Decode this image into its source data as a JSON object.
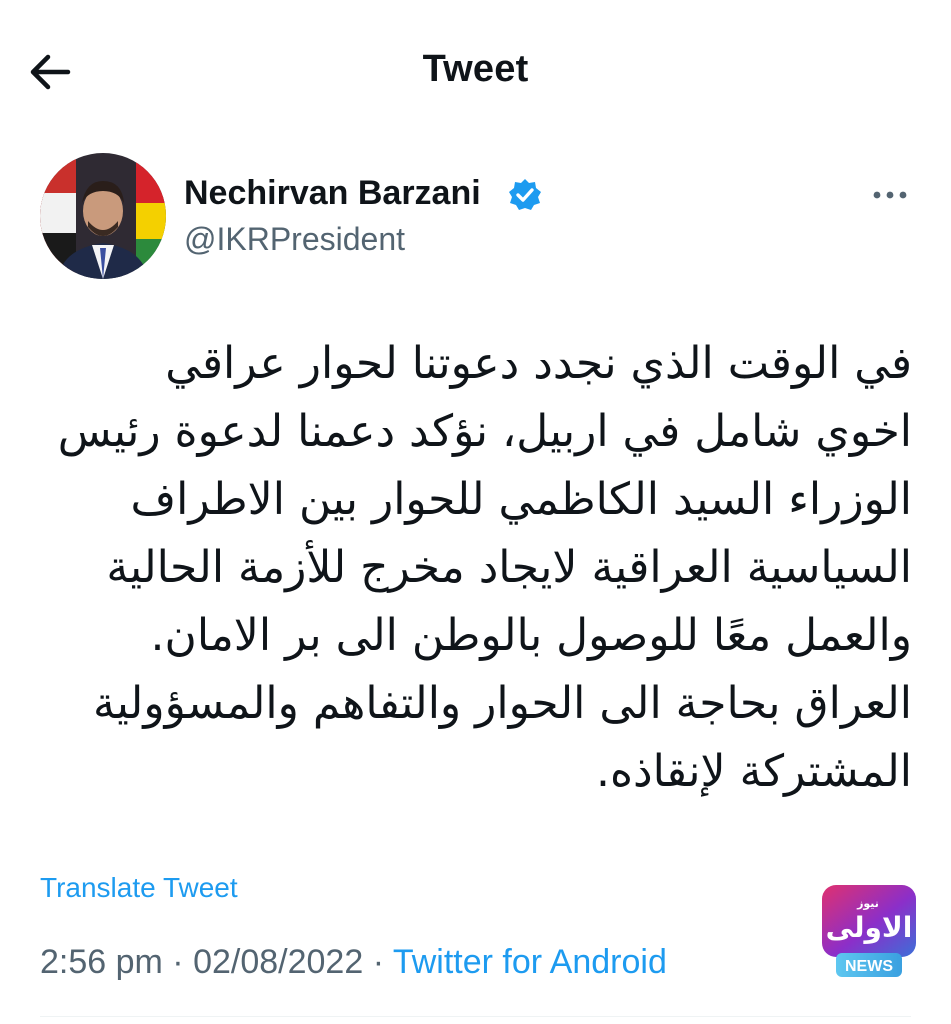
{
  "header": {
    "title": "Tweet",
    "back_icon": "arrow-left-icon"
  },
  "author": {
    "display_name": "Nechirvan Barzani",
    "handle": "@IKRPresident",
    "verified": true,
    "verified_icon": "verified-badge-icon",
    "more_icon": "more-horizontal-icon"
  },
  "tweet": {
    "text": "في الوقت الذي نجدد دعوتنا لحوار عراقي\nاخوي شامل في اربيل، نؤكد دعمنا لدعوة رئيس\nالوزراء السيد الكاظمي للحوار بين الاطراف\nالسياسية العراقية لايجاد مخرج للأزمة الحالية\nوالعمل معًا للوصول بالوطن الى بر الامان.\nالعراق بحاجة الى الحوار والتفاهم والمسؤولية\nالمشتركة لإنقاذه.",
    "translate_label": "Translate Tweet",
    "time": "2:56 pm",
    "separator": " · ",
    "date": "02/08/2022",
    "source": "Twitter for Android"
  },
  "watermark": {
    "logo_text": "الاولى",
    "logo_small": "نيوز",
    "badge": "NEWS"
  },
  "colors": {
    "accent": "#1d9bf0",
    "secondary_text": "#536471",
    "primary_text": "#0f1419"
  }
}
